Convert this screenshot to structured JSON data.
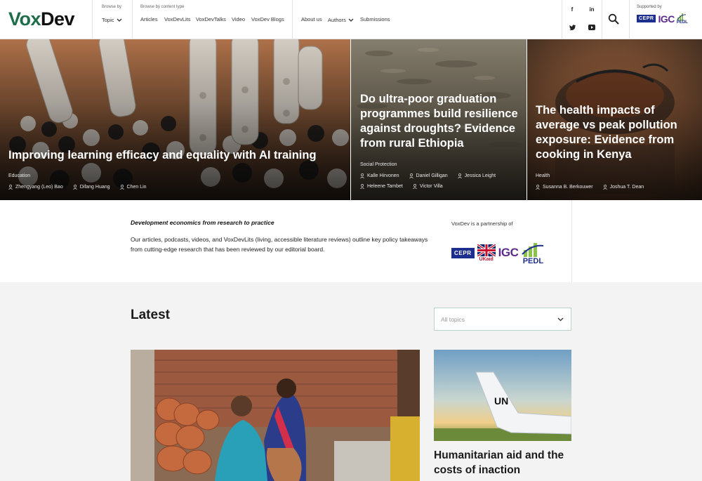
{
  "header": {
    "logo_part1": "Vox",
    "logo_part2": "Dev",
    "browse_by_caption": "Browse by",
    "topic_label": "Topic",
    "content_type_caption": "Browse by content type",
    "content_types": [
      "Articles",
      "VoxDevLits",
      "VoxDevTalks",
      "Video",
      "VoxDev Blogs"
    ],
    "about_label": "About us",
    "authors_label": "Authors",
    "submissions_label": "Submissions",
    "social_icons": [
      "facebook-icon",
      "linkedin-icon",
      "twitter-icon",
      "youtube-icon"
    ],
    "supported_by_caption": "Supported by",
    "sup_cepr": "CEPR",
    "sup_igc": "IGC",
    "sup_pedl": "PEDL"
  },
  "hero": [
    {
      "title": "Improving learning efficacy and equality with AI training",
      "category": "Education",
      "authors": [
        "Zhengyang (Leo) Bao",
        "Difang Huang",
        "Chen Lin"
      ]
    },
    {
      "title": "Do ultra-poor graduation programmes build resilience against droughts? Evidence from rural Ethiopia",
      "category": "Social Protection",
      "authors": [
        "Kalle Hirvonen",
        "Daniel Gilligan",
        "Jessica Leight",
        "Heleene Tambet",
        "Victor Villa"
      ]
    },
    {
      "title": "The health impacts of average vs peak pollution exposure: Evidence from cooking in Kenya",
      "category": "Health",
      "authors": [
        "Susanna B. Berkouwer",
        "Joshua T. Dean"
      ]
    }
  ],
  "intro": {
    "tagline": "Development economics from research to practice",
    "description": "Our articles, podcasts, videos, and VoxDevLits (living, accessible literature reviews) outline key policy takeaways from cutting-edge research that has been reviewed by our editorial board.",
    "partnership_caption": "VoxDev is a partnership of",
    "partner_cepr": "CEPR",
    "partner_ukaid": "UKaid",
    "partner_igc": "IGC",
    "partner_pedl": "PEDL"
  },
  "latest": {
    "heading": "Latest",
    "topic_placeholder": "All topics",
    "small_card_title": "Humanitarian aid and the costs of inaction",
    "plane_marking": "UN"
  },
  "colors": {
    "brand_green": "#1f6e4a",
    "cepr_blue": "#1c2f8e",
    "igc_purple": "#5b2c8a",
    "latest_bg": "#f3f3f3"
  }
}
